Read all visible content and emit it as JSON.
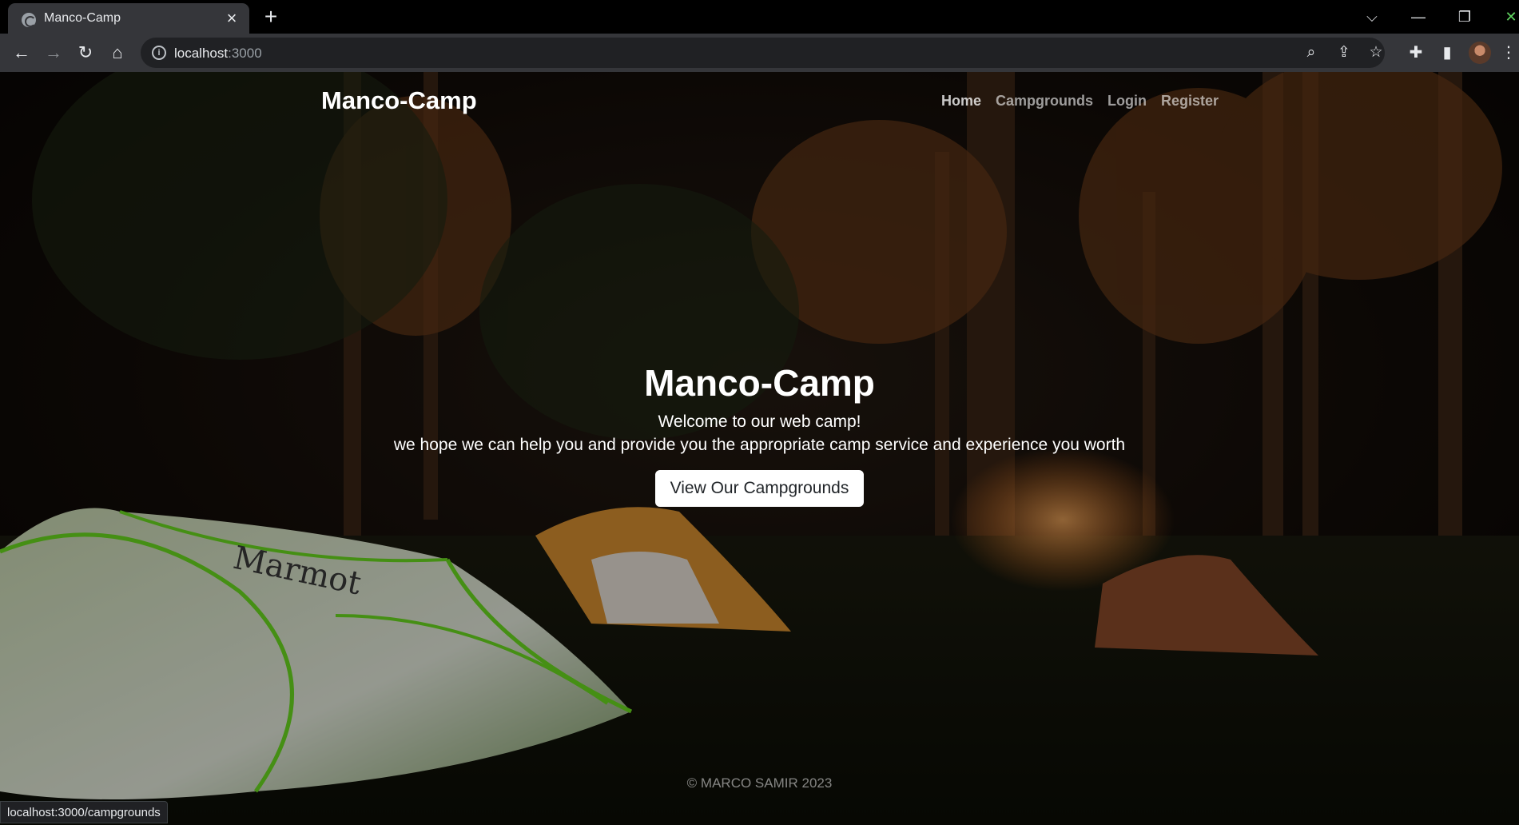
{
  "browser": {
    "tab_title": "Manco-Camp",
    "tab_close": "×",
    "new_tab": "+",
    "url_host": "localhost",
    "url_port": ":3000",
    "status_url": "localhost:3000/campgrounds"
  },
  "navbar": {
    "brand": "Manco-Camp",
    "links": [
      "Home",
      "Campgrounds",
      "Login",
      "Register"
    ]
  },
  "hero": {
    "title": "Manco-Camp",
    "welcome": "Welcome to our web camp!",
    "subtitle": "we hope we can help you and provide you the appropriate camp service and experience you worth",
    "cta_label": "View Our Campgrounds"
  },
  "footer": {
    "text": "© MARCO SAMIR 2023"
  },
  "colors": {
    "chrome_dark": "#000000",
    "chrome_toolbar": "#35363a",
    "cta_bg": "#ffffff"
  }
}
